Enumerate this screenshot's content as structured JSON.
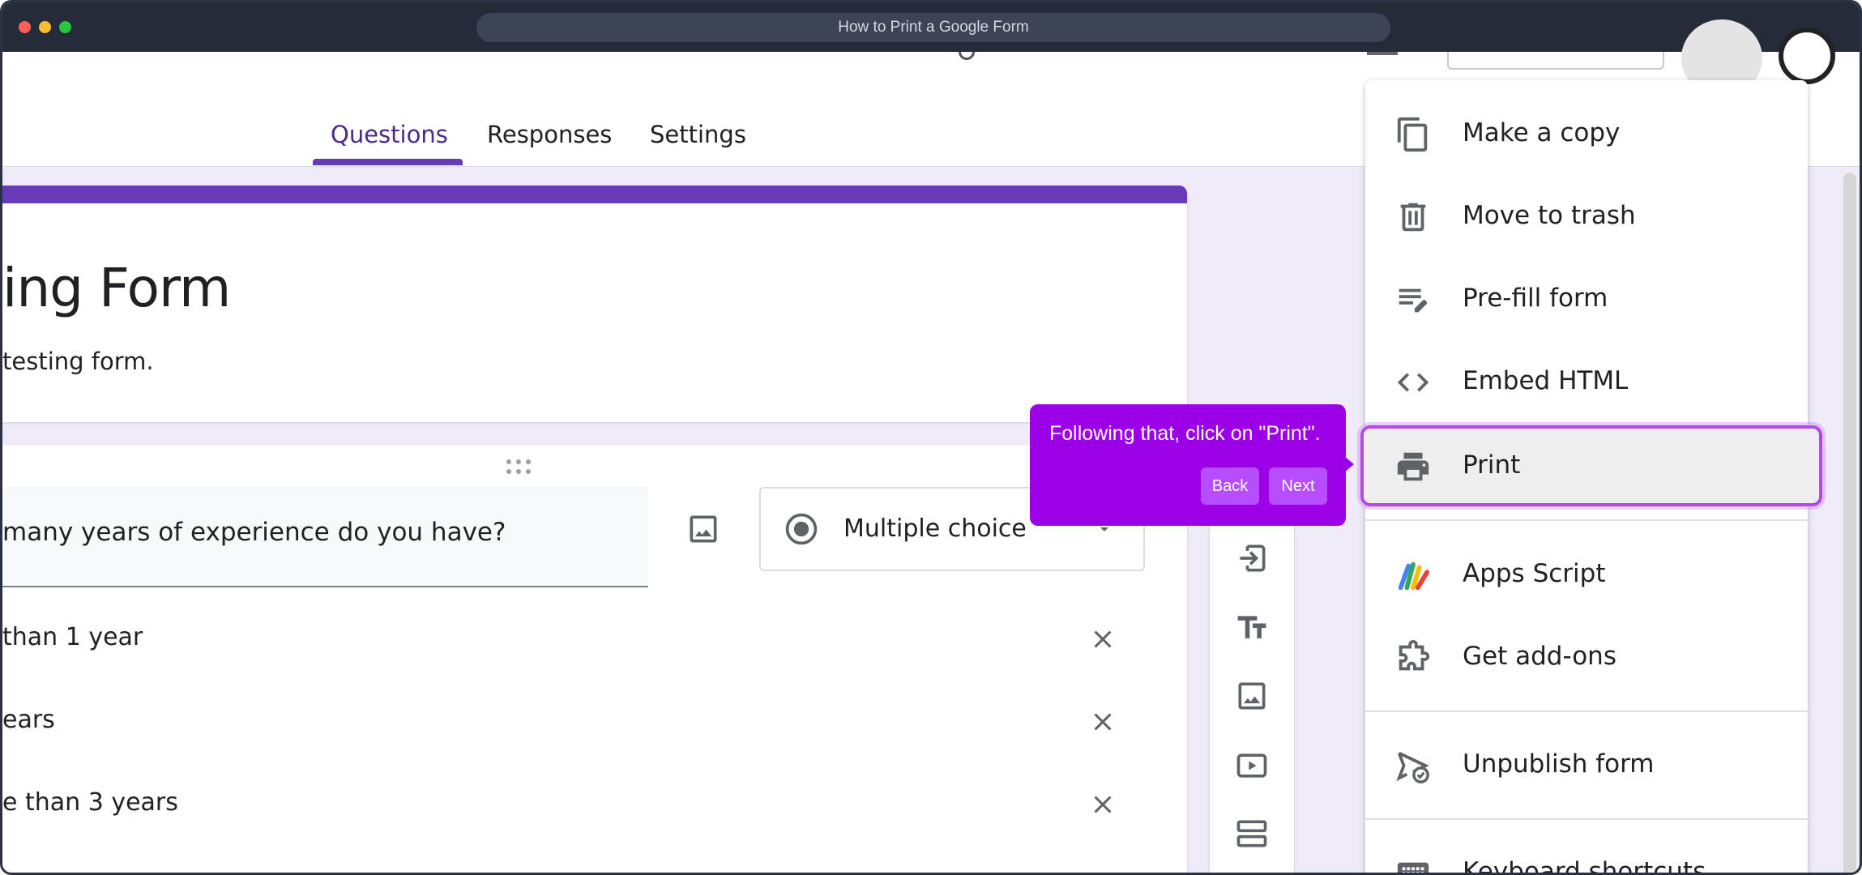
{
  "window": {
    "url_title": "How to Print a Google Form"
  },
  "tabs": [
    {
      "label": "Questions",
      "active": true
    },
    {
      "label": "Responses",
      "active": false
    },
    {
      "label": "Settings",
      "active": false
    }
  ],
  "form": {
    "title": "ing Form",
    "description": "testing form."
  },
  "question": {
    "text": "many years of experience do you have?",
    "type_label": "Multiple choice",
    "options": [
      {
        "label": " than 1 year"
      },
      {
        "label": "ears"
      },
      {
        "label": "e than 3 years"
      }
    ]
  },
  "side_toolbar": {
    "icons": [
      "import-questions-icon",
      "title-text-icon",
      "add-image-icon",
      "add-video-icon",
      "add-section-icon"
    ]
  },
  "tooltip": {
    "text": "Following that, click on \"Print\".",
    "back_label": "Back",
    "next_label": "Next"
  },
  "menu": {
    "items": [
      {
        "label": "Make a copy",
        "icon": "copy-icon"
      },
      {
        "label": "Move to trash",
        "icon": "trash-icon"
      },
      {
        "label": "Pre-fill form",
        "icon": "prefill-icon"
      },
      {
        "label": "Embed HTML",
        "icon": "code-icon"
      },
      {
        "label": "Print",
        "icon": "printer-icon",
        "highlighted": true
      },
      {
        "label": "Apps Script",
        "icon": "apps-script-icon"
      },
      {
        "label": "Get add-ons",
        "icon": "addons-puzzle-icon"
      },
      {
        "label": "Unpublish form",
        "icon": "unpublish-icon"
      },
      {
        "label": "Keyboard shortcuts",
        "icon": "keyboard-icon"
      }
    ]
  },
  "colors": {
    "accent": "#673ab7",
    "tooltip": "#9b00e8",
    "highlight_ring": "#b04ae8",
    "page_bg": "#f0ebf8"
  }
}
